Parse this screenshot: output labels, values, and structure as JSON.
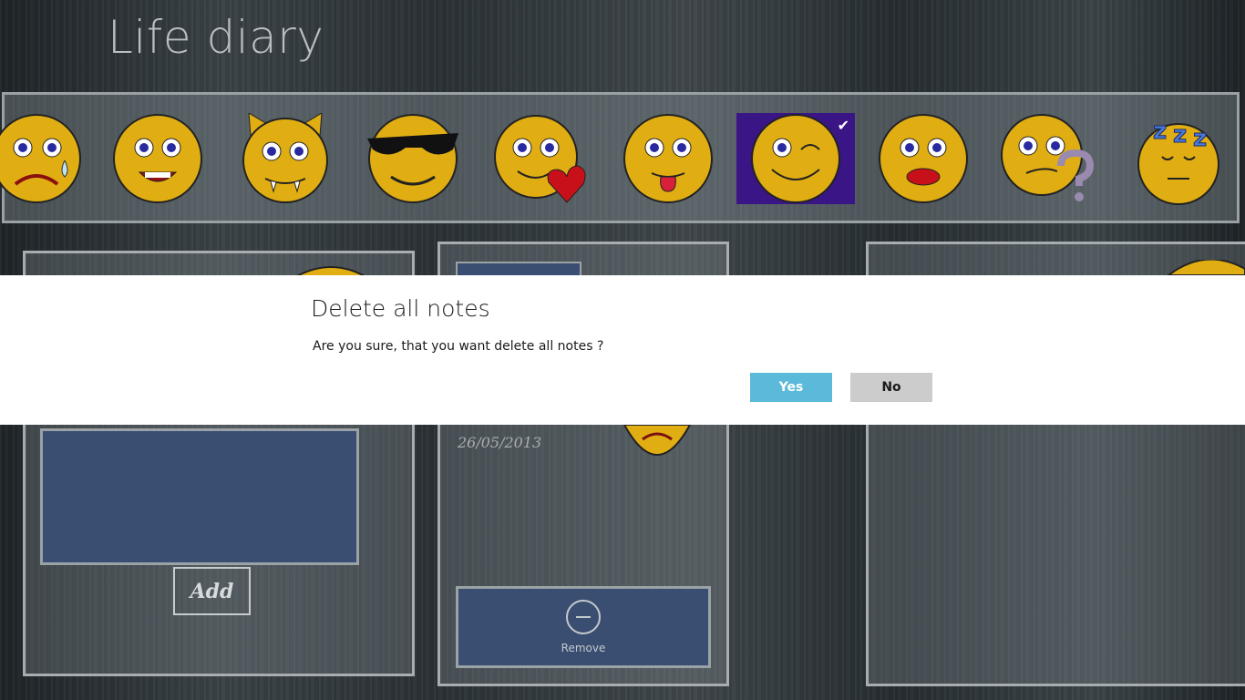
{
  "app": {
    "title": "Life diary"
  },
  "moods": [
    {
      "icon": "crying-face-icon",
      "selected": false
    },
    {
      "icon": "grinning-face-icon",
      "selected": false
    },
    {
      "icon": "devil-face-icon",
      "selected": false
    },
    {
      "icon": "sunglasses-face-icon",
      "selected": false
    },
    {
      "icon": "love-face-icon",
      "selected": false
    },
    {
      "icon": "tongue-face-icon",
      "selected": false
    },
    {
      "icon": "winking-face-icon",
      "selected": true
    },
    {
      "icon": "surprised-face-icon",
      "selected": false
    },
    {
      "icon": "confused-face-icon",
      "selected": false
    },
    {
      "icon": "sleeping-face-icon",
      "selected": false
    }
  ],
  "new_note": {
    "add_label": "Add"
  },
  "note_card": {
    "date": "26/05/2013",
    "remove_label": "Remove"
  },
  "dialog": {
    "title": "Delete all notes",
    "message": "Are you sure, that you want delete all notes ?",
    "yes_label": "Yes",
    "no_label": "No"
  },
  "colors": {
    "accent_yes": "#5bb9d9",
    "selected_mood": "#3a1585",
    "input_fill": "#3a4e72"
  }
}
